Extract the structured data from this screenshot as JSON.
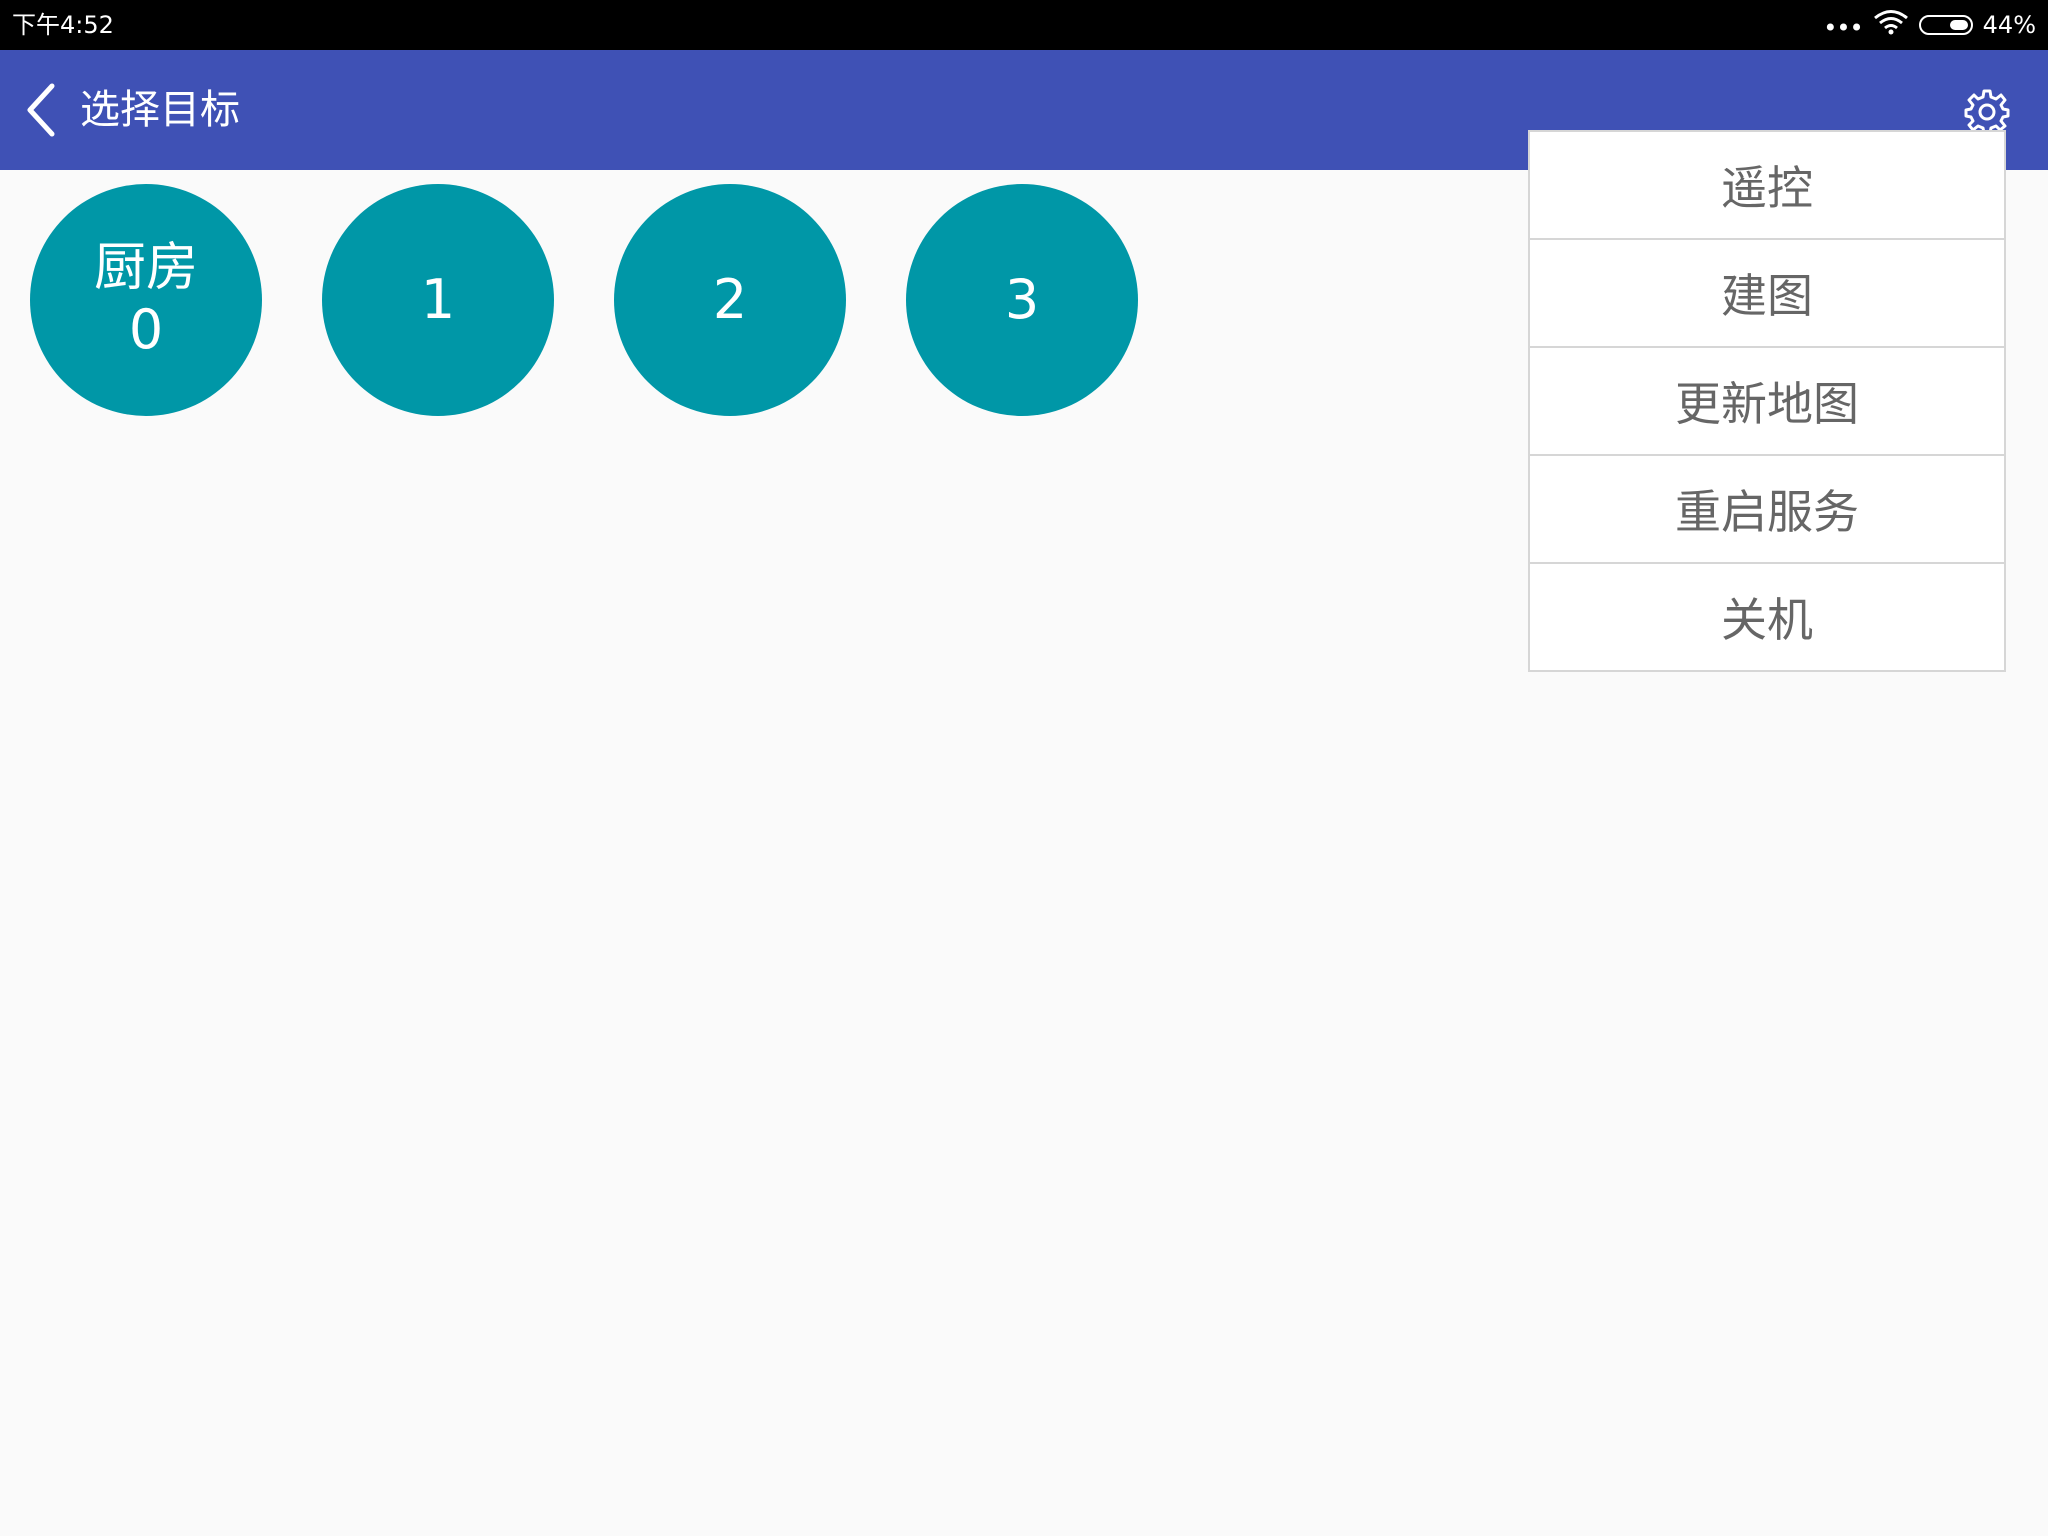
{
  "status_bar": {
    "time": "下午4:52",
    "dots_icon": "more-dots-icon",
    "wifi_icon": "wifi-icon",
    "battery_icon": "battery-icon",
    "battery_percent": "44%"
  },
  "app_bar": {
    "back_icon": "chevron-left-icon",
    "title": "选择目标",
    "settings_icon": "gear-icon",
    "background_color": "#3f51b5"
  },
  "targets": [
    {
      "name": "厨房",
      "number": "0"
    },
    {
      "name": "",
      "number": "1"
    },
    {
      "name": "",
      "number": "2"
    },
    {
      "name": "",
      "number": "3"
    }
  ],
  "target_color": "#0097a7",
  "menu": {
    "items": [
      {
        "label": "遥控"
      },
      {
        "label": "建图"
      },
      {
        "label": "更新地图"
      },
      {
        "label": "重启服务"
      },
      {
        "label": "关机"
      }
    ]
  }
}
